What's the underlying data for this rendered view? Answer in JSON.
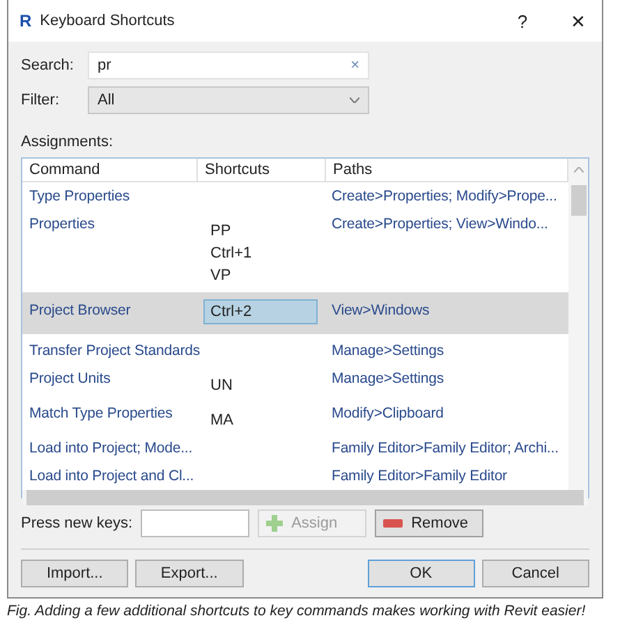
{
  "window": {
    "title": "Keyboard Shortcuts",
    "help": "?",
    "close": "✕",
    "logo": "R"
  },
  "search": {
    "label": "Search:",
    "value": "pr",
    "clear": "×"
  },
  "filter": {
    "label": "Filter:",
    "value": "All"
  },
  "assignments": {
    "label": "Assignments:",
    "columns": [
      "Command",
      "Shortcuts",
      "Paths"
    ],
    "rows": [
      {
        "command": "Type Properties",
        "shortcuts": [],
        "paths": "Create>Properties; Modify>Prope...",
        "selected": false
      },
      {
        "command": "Properties",
        "shortcuts": [
          "PP",
          "Ctrl+1",
          "VP"
        ],
        "paths": "Create>Properties; View>Windo...",
        "selected": false
      },
      {
        "command": "Project Browser",
        "shortcuts": [
          "Ctrl+2"
        ],
        "paths": "View>Windows",
        "selected": true
      },
      {
        "command": "Transfer Project Standards",
        "shortcuts": [],
        "paths": "Manage>Settings",
        "selected": false
      },
      {
        "command": "Project Units",
        "shortcuts": [
          "UN"
        ],
        "paths": "Manage>Settings",
        "selected": false
      },
      {
        "command": "Match Type Properties",
        "shortcuts": [
          "MA"
        ],
        "paths": "Modify>Clipboard",
        "selected": false
      },
      {
        "command": "Load into Project; Mode...",
        "shortcuts": [],
        "paths": "Family Editor>Family Editor; Archi...",
        "selected": false
      },
      {
        "command": "Load into Project and Cl...",
        "shortcuts": [],
        "paths": "Family Editor>Family Editor",
        "selected": false
      }
    ]
  },
  "new_keys": {
    "label": "Press new keys:"
  },
  "actions": [
    {
      "label": "Assign",
      "kind": "assign",
      "disabled": true
    },
    {
      "label": "Remove",
      "kind": "remove",
      "disabled": false
    }
  ],
  "footer_buttons": [
    {
      "label": "Import...",
      "default": false
    },
    {
      "label": "Export...",
      "default": false
    },
    {
      "label": "OK",
      "default": true
    },
    {
      "label": "Cancel",
      "default": false
    }
  ],
  "caption": "Fig. Adding a few additional shortcuts to key commands makes working with Revit easier!"
}
